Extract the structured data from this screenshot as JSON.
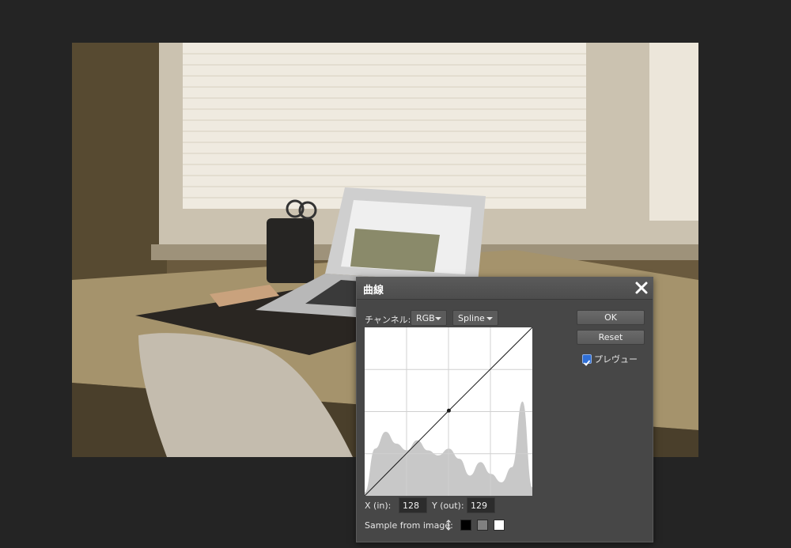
{
  "dialog": {
    "title": "曲線",
    "channel_label": "チャンネル:",
    "channel_value": "RGB",
    "curve_type_value": "Spline",
    "ok_label": "OK",
    "reset_label": "Reset",
    "preview_label": "プレヴュー",
    "preview_checked": true,
    "x_label": "X (in):",
    "x_value": "128",
    "y_label": "Y (out):",
    "y_value": "129",
    "sample_label": "Sample from image:",
    "sample_icon": "up-down-arrow-icon",
    "swatches": [
      "#000000",
      "#808080",
      "#ffffff"
    ]
  },
  "chart_data": {
    "type": "area",
    "x": [
      0,
      16,
      32,
      48,
      64,
      80,
      96,
      112,
      128,
      144,
      160,
      176,
      192,
      208,
      224,
      240,
      255
    ],
    "histogram": [
      0.02,
      0.28,
      0.38,
      0.31,
      0.27,
      0.33,
      0.27,
      0.24,
      0.28,
      0.22,
      0.12,
      0.2,
      0.13,
      0.08,
      0.17,
      0.56,
      0.05
    ],
    "curve_points": [
      [
        0,
        0
      ],
      [
        128,
        129
      ],
      [
        255,
        255
      ]
    ],
    "xlim": [
      0,
      255
    ],
    "ylim": [
      0,
      255
    ],
    "grid": true
  }
}
